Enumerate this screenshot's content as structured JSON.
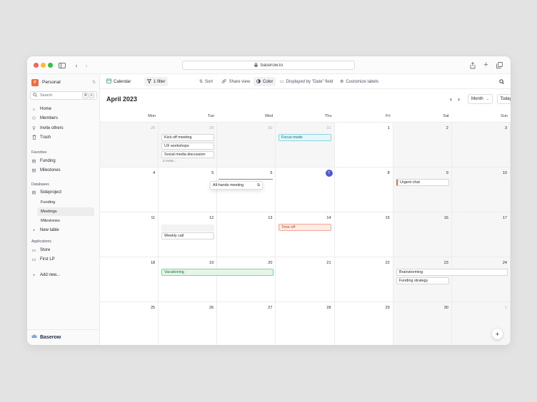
{
  "browser": {
    "url": "baserow.io",
    "traffic_colors": [
      "#ff5f57",
      "#febc2e",
      "#28c840"
    ]
  },
  "sidebar": {
    "workspace": "Personal",
    "workspace_initial": "P",
    "search_placeholder": "Search",
    "search_shortcut": [
      "⌘",
      "K"
    ],
    "nav": [
      {
        "label": "Home",
        "icon": "home-icon"
      },
      {
        "label": "Members",
        "icon": "members-icon"
      },
      {
        "label": "Invite others",
        "icon": "invite-icon"
      },
      {
        "label": "Trash",
        "icon": "trash-icon"
      }
    ],
    "favorites_title": "Favorites",
    "favorites": [
      {
        "label": "Funding",
        "icon": "table-icon"
      },
      {
        "label": "Milestones",
        "icon": "table-icon"
      }
    ],
    "databases_title": "Databases",
    "database": "Sideproject",
    "tables": [
      "Funding",
      "Meetings",
      "Milestones"
    ],
    "active_table": "Meetings",
    "new_table": "New table",
    "applications_title": "Applications",
    "applications": [
      "Store",
      "First LP"
    ],
    "add_new": "Add new...",
    "brand": "Baserow"
  },
  "toolbar": {
    "view": "Calendar",
    "filter": "1 filter",
    "sort": "Sort",
    "share": "Share view",
    "color": "Color",
    "displayed_by": "Displayed by \"Date\" field",
    "customize": "Customize labels"
  },
  "calendar": {
    "month_title": "April 2023",
    "view_mode": "Month",
    "today_label": "Today",
    "weekdays": [
      "Mon",
      "Tue",
      "Wed",
      "Thu",
      "Fri",
      "Sat",
      "Sun"
    ],
    "weeks": [
      [
        "28",
        "29",
        "30",
        "31",
        "1",
        "2",
        "3"
      ],
      [
        "4",
        "5",
        "6",
        "7",
        "8",
        "9",
        "10"
      ],
      [
        "11",
        "12",
        "13",
        "14",
        "15",
        "16",
        "17"
      ],
      [
        "18",
        "19",
        "20",
        "21",
        "22",
        "23",
        "24"
      ],
      [
        "25",
        "26",
        "27",
        "28",
        "29",
        "30",
        "1"
      ]
    ],
    "today": "7",
    "more_label": "2 more...",
    "events": {
      "kickoff": "Kick-off meeting",
      "ux": "UX workshops",
      "social": "Social media discussion",
      "focus": "Focus mode",
      "allhands": "All-hands meeting",
      "urgent": "Urgent chat",
      "timeoff": "Time off",
      "weekly": "Weekly call",
      "vacation": "Vacationing",
      "brainstorm": "Brainstorming",
      "funding": "Funding strategy"
    },
    "event_colors": {
      "accent": "#4f5bd5",
      "cyan": "#e6f7fa",
      "red": "#fdebe6",
      "green": "#e4f6e8"
    }
  }
}
